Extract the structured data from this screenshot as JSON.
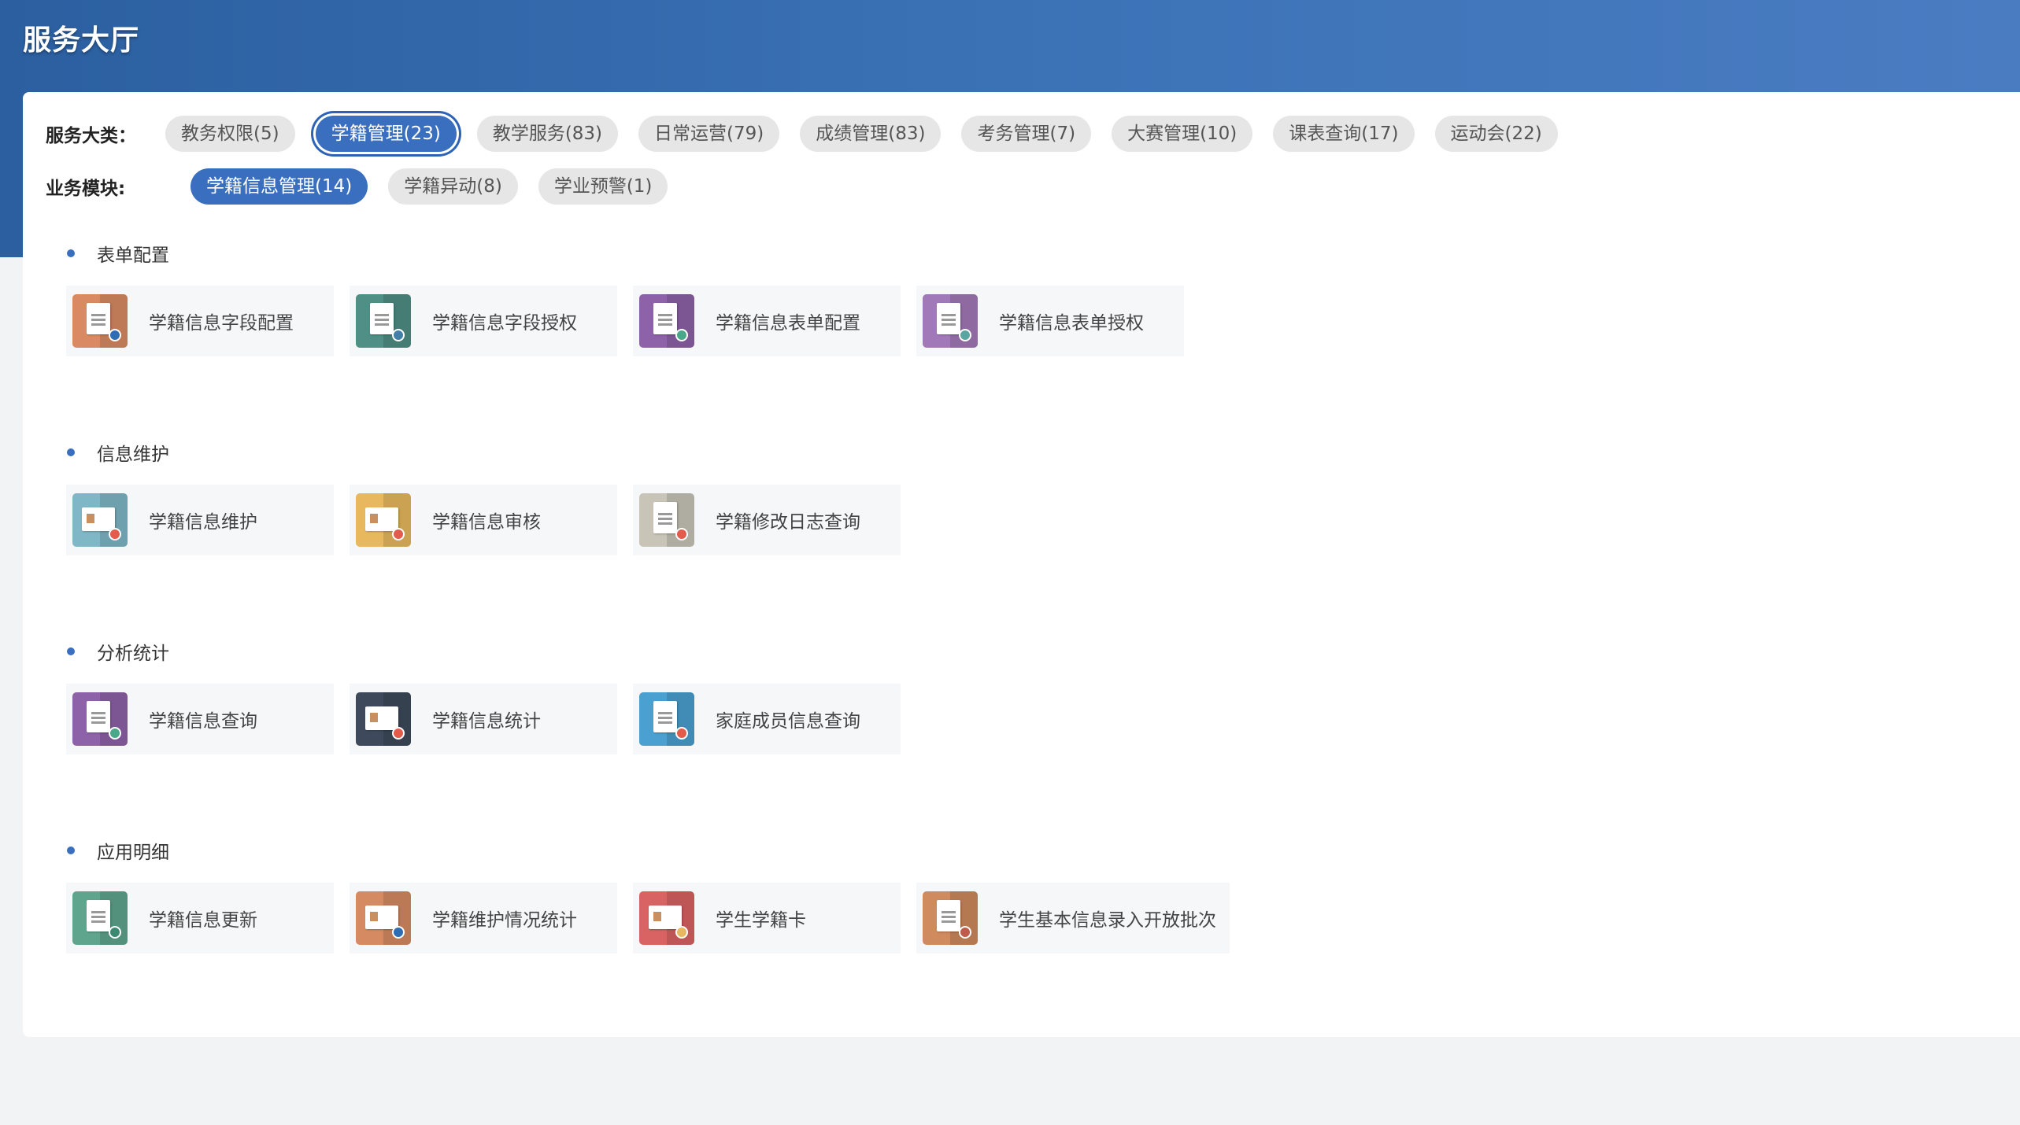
{
  "page": {
    "title": "服务大厅"
  },
  "filters": {
    "category_label": "服务大类：",
    "categories": [
      {
        "label": "教务权限(5)",
        "active": false
      },
      {
        "label": "学籍管理(23)",
        "active": true
      },
      {
        "label": "教学服务(83)",
        "active": false
      },
      {
        "label": "日常运营(79)",
        "active": false
      },
      {
        "label": "成绩管理(83)",
        "active": false
      },
      {
        "label": "考务管理(7)",
        "active": false
      },
      {
        "label": "大赛管理(10)",
        "active": false
      },
      {
        "label": "课表查询(17)",
        "active": false
      },
      {
        "label": "运动会(22)",
        "active": false
      }
    ],
    "module_label": "业务模块:",
    "modules": [
      {
        "label": "学籍信息管理(14)",
        "active": true
      },
      {
        "label": "学籍异动(8)",
        "active": false
      },
      {
        "label": "学业预警(1)",
        "active": false
      }
    ]
  },
  "sections": [
    {
      "title": "表单配置",
      "items": [
        {
          "label": "学籍信息字段配置",
          "icon": "document-gear-icon",
          "color": "#d98a62",
          "badge": "#2f6db3"
        },
        {
          "label": "学籍信息字段授权",
          "icon": "document-user-icon",
          "color": "#4f8f86",
          "badge": "#3f7fa8"
        },
        {
          "label": "学籍信息表单配置",
          "icon": "document-search-icon",
          "color": "#8e62a8",
          "badge": "#4aa88a"
        },
        {
          "label": "学籍信息表单授权",
          "icon": "document-user-icon",
          "color": "#a279b8",
          "badge": "#5aa5a0"
        }
      ]
    },
    {
      "title": "信息维护",
      "items": [
        {
          "label": "学籍信息维护",
          "icon": "id-card-edit-icon",
          "color": "#7fb7c6",
          "badge": "#e25b4b"
        },
        {
          "label": "学籍信息审核",
          "icon": "id-card-check-icon",
          "color": "#e8b85e",
          "badge": "#e25b4b"
        },
        {
          "label": "学籍修改日志查询",
          "icon": "clipboard-search-icon",
          "color": "#c8c4b8",
          "badge": "#e25b4b"
        }
      ]
    },
    {
      "title": "分析统计",
      "items": [
        {
          "label": "学籍信息查询",
          "icon": "document-search-icon",
          "color": "#8e62a8",
          "badge": "#4aa88a"
        },
        {
          "label": "学籍信息统计",
          "icon": "chart-card-icon",
          "color": "#3e4a5c",
          "badge": "#e25b4b"
        },
        {
          "label": "家庭成员信息查询",
          "icon": "document-search-icon",
          "color": "#4aa0d0",
          "badge": "#e25b4b"
        }
      ]
    },
    {
      "title": "应用明细",
      "items": [
        {
          "label": "学籍信息更新",
          "icon": "refresh-document-icon",
          "color": "#5fa58e",
          "badge": "#3a8a72"
        },
        {
          "label": "学籍维护情况统计",
          "icon": "monitor-chart-icon",
          "color": "#d68a62",
          "badge": "#2f6db3"
        },
        {
          "label": "学生学籍卡",
          "icon": "student-card-icon",
          "color": "#d96262",
          "badge": "#e8b85e"
        },
        {
          "label": "学生基本信息录入开放批次",
          "icon": "clipboard-list-icon",
          "color": "#cf8a5e",
          "badge": "#c05a4a"
        }
      ]
    }
  ]
}
